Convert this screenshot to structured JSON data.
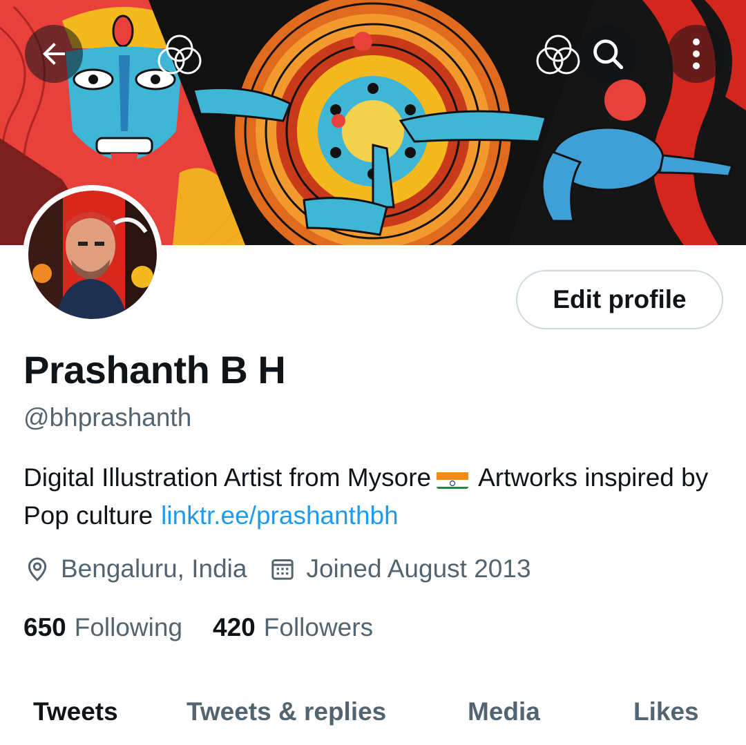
{
  "header": {
    "back_icon": "arrow-left-icon",
    "search_icon": "search-icon",
    "more_icon": "more-vertical-icon"
  },
  "profile": {
    "display_name": "Prashanth B H",
    "handle": "@bhprashanth",
    "edit_button_label": "Edit profile",
    "bio": {
      "text_before_flag": "Digital Illustration Artist from Mysore",
      "flag": "india-flag-emoji",
      "text_after_flag": "Artworks inspired by Pop culture",
      "link": "linktr.ee/prashanthbh"
    },
    "location": "Bengaluru, India",
    "joined": "Joined August 2013",
    "following_count": "650",
    "following_label": "Following",
    "followers_count": "420",
    "followers_label": "Followers"
  },
  "tabs": [
    {
      "label": "Tweets",
      "active": true
    },
    {
      "label": "Tweets & replies",
      "active": false
    },
    {
      "label": "Media",
      "active": false
    },
    {
      "label": "Likes",
      "active": false
    }
  ],
  "colors": {
    "text_primary": "#0f1419",
    "text_secondary": "#536471",
    "link": "#1d9bf0",
    "border": "#cfd9de"
  }
}
